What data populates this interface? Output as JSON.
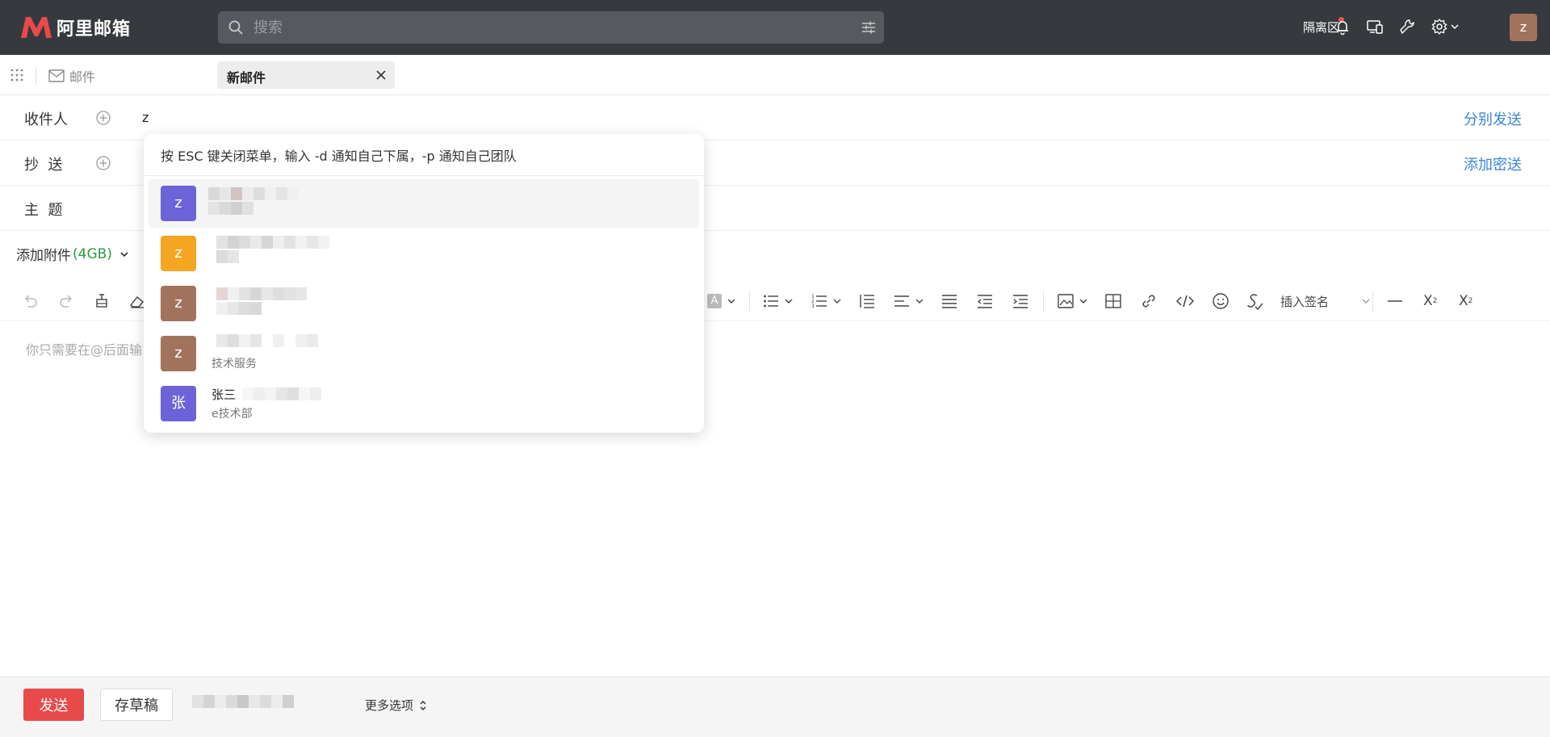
{
  "brand": {
    "name": "阿里邮箱",
    "color": "#e84a4a"
  },
  "search": {
    "placeholder": "搜索"
  },
  "header": {
    "quarantine_label": "隔离区",
    "user_avatar_letter": "z"
  },
  "tabbar": {
    "mail_label": "邮件",
    "active_tab_label": "新邮件"
  },
  "compose": {
    "to_label": "收件人",
    "to_value": "z",
    "split_send_label": "分别发送",
    "cc_label": "抄  送",
    "bcc_label": "添加密送",
    "subject_label": "主  题",
    "attach_label": "添加附件",
    "attach_size": "(4GB)",
    "signature_label": "插入签名",
    "editor_placeholder": "你只需要在@后面输"
  },
  "dropdown": {
    "hint": "按 ESC 键关闭菜单，输入 -d 通知自己下属，-p 通知自己团队",
    "contacts": [
      {
        "letter": "z",
        "color": "#6c63d9",
        "name": "",
        "dept": ""
      },
      {
        "letter": "z",
        "color": "#f4a623",
        "name": "",
        "dept": ""
      },
      {
        "letter": "z",
        "color": "#a2735c",
        "name": "",
        "dept": ""
      },
      {
        "letter": "z",
        "color": "#a2735c",
        "name": "",
        "dept": "技术服务"
      },
      {
        "letter": "张",
        "color": "#6c63d9",
        "name": "张三",
        "dept": "e技术部"
      }
    ]
  },
  "footer": {
    "send_label": "发送",
    "draft_label": "存草稿",
    "more_options_label": "更多选项"
  }
}
